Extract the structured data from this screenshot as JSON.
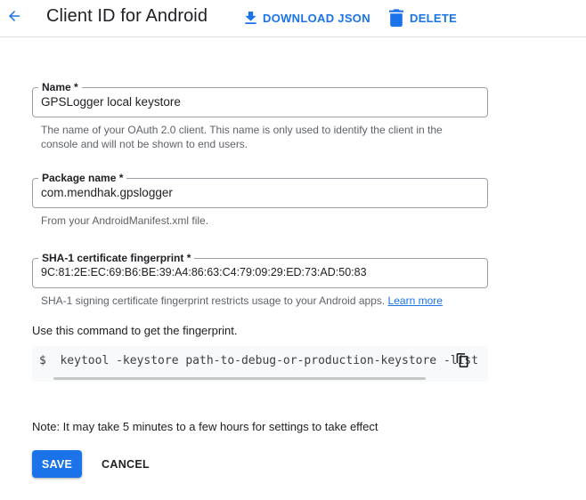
{
  "header": {
    "title": "Client ID for Android",
    "back_icon": "arrow-back-icon",
    "download_label": "DOWNLOAD JSON",
    "download_icon": "download-icon",
    "delete_label": "DELETE",
    "delete_icon": "trash-icon",
    "accent_color": "#1a73e8"
  },
  "form": {
    "name": {
      "label": "Name *",
      "value": "GPSLogger local keystore",
      "help": "The name of your OAuth 2.0 client. This name is only used to identify the client in the console and will not be shown to end users."
    },
    "package": {
      "label": "Package name *",
      "value": "com.mendhak.gpslogger",
      "help": "From your AndroidManifest.xml file."
    },
    "sha1": {
      "label": "SHA-1 certificate fingerprint *",
      "value": "9C:81:2E:EC:69:B6:BE:39:A4:86:63:C4:79:09:29:ED:73:AD:50:83",
      "help": "SHA-1 signing certificate fingerprint restricts usage to your Android apps.",
      "help_link": "Learn more"
    }
  },
  "command": {
    "intro": "Use this command to get the fingerprint.",
    "code": "$  keytool -keystore path-to-debug-or-production-keystore -list",
    "copy_icon": "copy-icon"
  },
  "note": "Note: It may take 5 minutes to a few hours for settings to take effect",
  "actions": {
    "save_label": "SAVE",
    "cancel_label": "CANCEL"
  }
}
